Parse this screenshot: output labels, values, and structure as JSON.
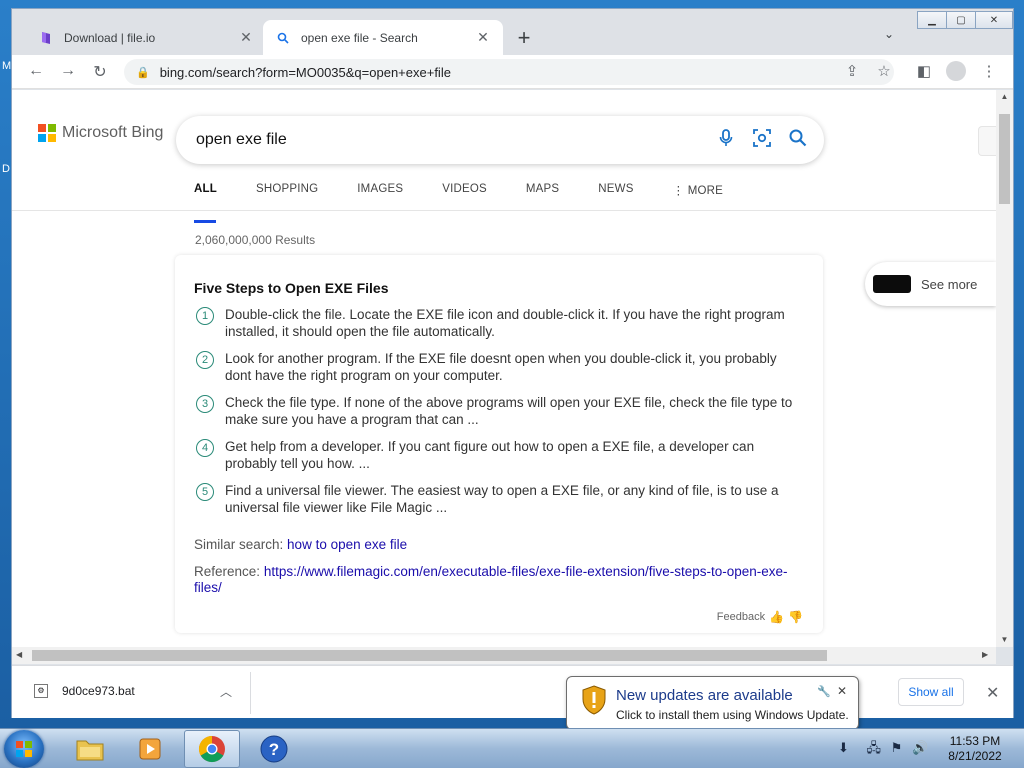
{
  "desktop": {
    "letters": [
      "M",
      "D"
    ]
  },
  "browser": {
    "tabs": [
      {
        "title": "Download | file.io",
        "favicon": "fileio-icon"
      },
      {
        "title": "open exe file - Search",
        "favicon": "search-icon"
      }
    ],
    "url": "bing.com/search?form=MO0035&q=open+exe+file"
  },
  "bing": {
    "logo_text": "Microsoft Bing",
    "query": "open exe file",
    "scopes": [
      "ALL",
      "SHOPPING",
      "IMAGES",
      "VIDEOS",
      "MAPS",
      "NEWS",
      "MORE"
    ],
    "results_count": "2,060,000,000 Results",
    "card": {
      "title": "Five Steps to Open EXE Files",
      "steps": [
        {
          "n": "1",
          "text": "Double-click the file. Locate the EXE file icon and double-click it. If you have the right program installed, it should open the file automatically."
        },
        {
          "n": "2",
          "text": "Look for another program. If the EXE file doesnt open when you double-click it, you probably dont have the right program on your computer."
        },
        {
          "n": "3",
          "text": "Check the file type. If none of the above programs will open your EXE file, check the file type to make sure you have a program that can ..."
        },
        {
          "n": "4",
          "text": "Get help from a developer. If you cant figure out how to open a EXE file, a developer can probably tell you how. ..."
        },
        {
          "n": "5",
          "text": "Find a universal file viewer. The easiest way to open a EXE file, or any kind of file, is to use a universal file viewer like File Magic ..."
        }
      ],
      "similar_label": "Similar search:",
      "similar_link": "how to open exe file",
      "reference_label": "Reference:",
      "reference_link": "https://www.filemagic.com/en/executable-files/exe-file-extension/five-steps-to-open-exe-files/",
      "feedback": "Feedback"
    },
    "see_more": "See more"
  },
  "downloads": {
    "file": "9d0ce973.bat",
    "show_all": "Show all"
  },
  "balloon": {
    "title": "New updates are available",
    "body": "Click to install them using Windows Update."
  },
  "taskbar": {
    "time": "11:53 PM",
    "date": "8/21/2022"
  },
  "colors": {
    "bing_blue": "#174ae4",
    "link": "#1a0dab",
    "step_green": "#2a8a78"
  }
}
